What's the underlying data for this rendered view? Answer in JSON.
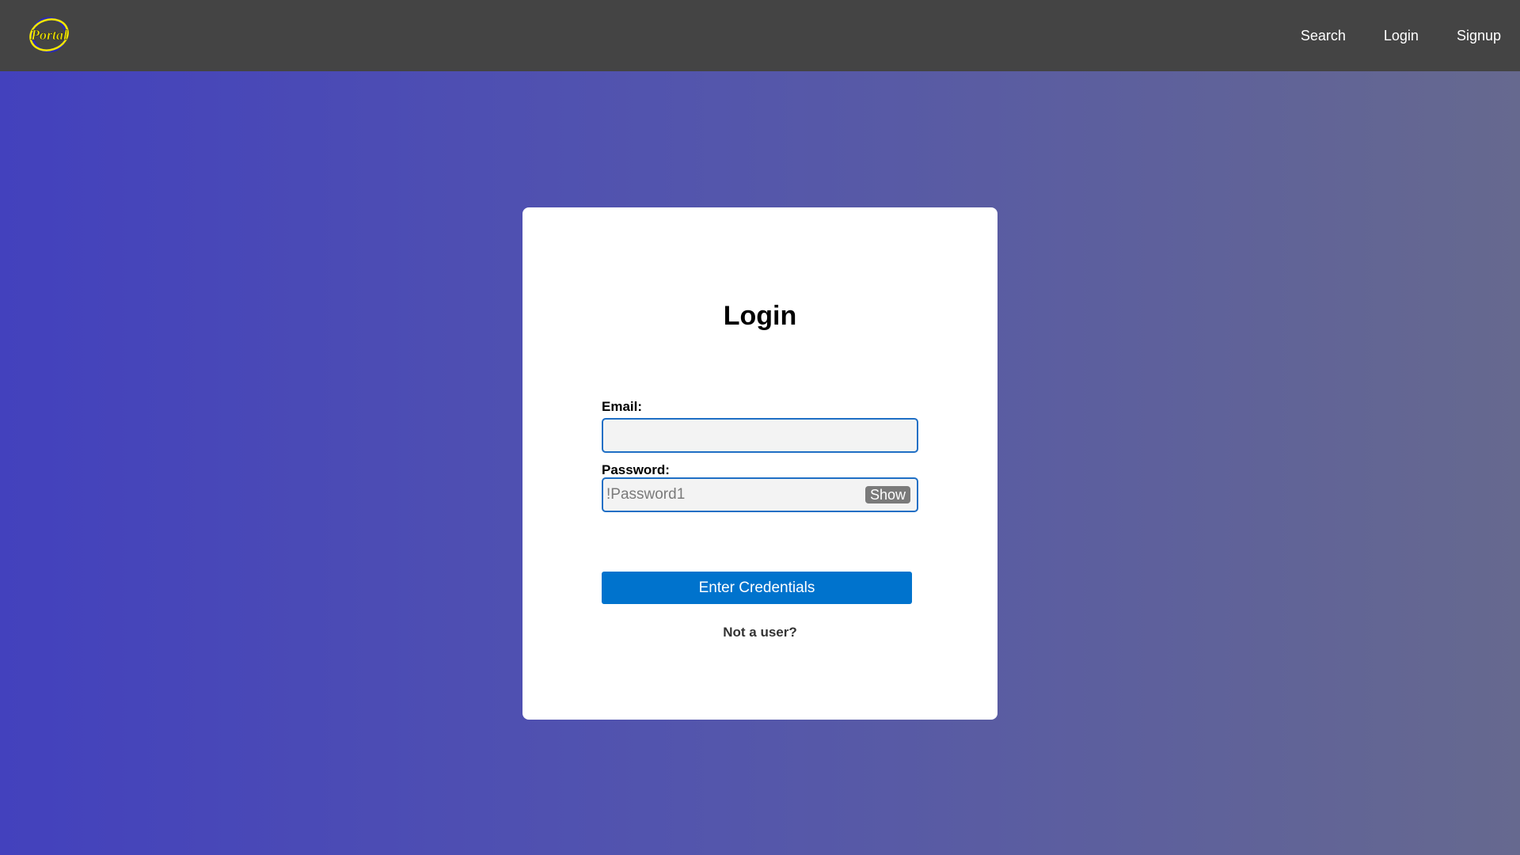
{
  "navbar": {
    "logo_text": "Portal",
    "links": [
      "Search",
      "Login",
      "Signup"
    ]
  },
  "login": {
    "title": "Login",
    "email_label": "Email:",
    "email_value": "",
    "password_label": "Password:",
    "password_placeholder": "!Password1",
    "password_value": "",
    "show_label": "Show",
    "submit_label": "Enter Credentials",
    "signup_link": "Not a user?"
  },
  "colors": {
    "navbar_bg": "#444444",
    "primary_button": "#0073cd",
    "input_border": "#1f6fc5",
    "logo_yellow": "#f2e600",
    "logo_blue": "#2c2caf",
    "background_left": "#4341bd",
    "background_right": "#66698f"
  },
  "icons": {
    "logo": "portal-logo-icon"
  }
}
